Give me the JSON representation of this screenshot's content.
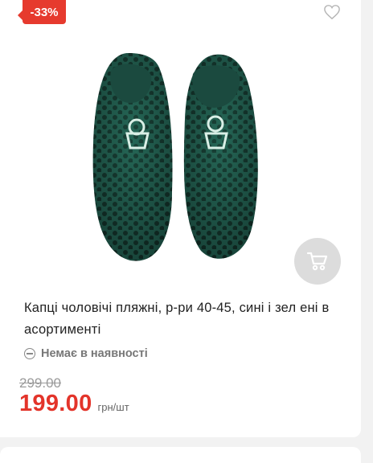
{
  "badge": {
    "discount": "-33%"
  },
  "product": {
    "title": "Капці чоловічі пляжні, р-ри 40-45, сині і зел ені в асортименті",
    "availability": "Немає в наявності",
    "old_price": "299.00",
    "price": "199.00",
    "unit": "грн/шт",
    "image_icon": "slippers-image"
  },
  "icons": {
    "wishlist": "heart-outline-icon",
    "cart": "cart-icon",
    "stock": "minus-circle-icon"
  },
  "colors": {
    "accent": "#e3342a",
    "badge": "#e63a2e",
    "cart_button": "#dcdcdc",
    "muted": "#777777",
    "slipper": "#1f5a4c"
  }
}
